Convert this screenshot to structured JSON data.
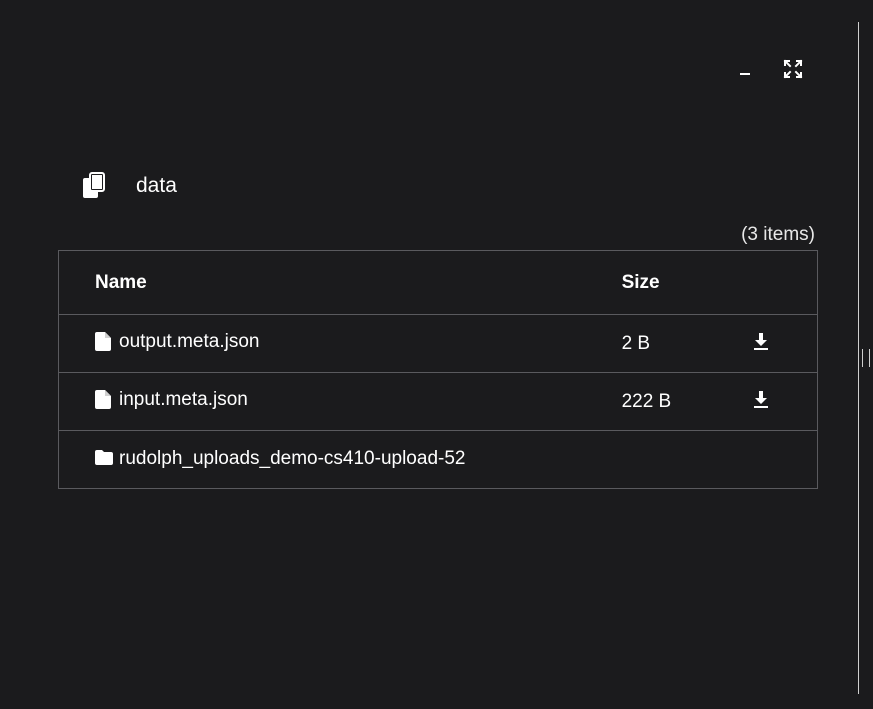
{
  "window": {
    "minimize_icon": "minimize-icon",
    "maximize_icon": "expand-icon"
  },
  "folder": {
    "title": "data",
    "icon": "copy-files-icon",
    "item_count": "(3 items)"
  },
  "table": {
    "headers": {
      "name": "Name",
      "size": "Size"
    },
    "rows": [
      {
        "type": "file",
        "icon": "file-icon",
        "name": "output.meta.json",
        "size": "2 B",
        "download_icon": "download-icon"
      },
      {
        "type": "file",
        "icon": "file-icon",
        "name": "input.meta.json",
        "size": "222 B",
        "download_icon": "download-icon"
      },
      {
        "type": "folder",
        "icon": "folder-icon",
        "name": "rudolph_uploads_demo-cs410-upload-52",
        "size": ""
      }
    ]
  },
  "colors": {
    "background": "#1b1b1d",
    "text": "#ffffff",
    "border": "#5a5a5e"
  }
}
